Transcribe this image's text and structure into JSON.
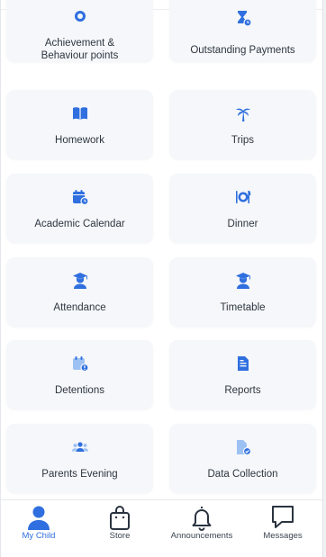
{
  "tiles": [
    {
      "label": "Achievement &\nBehaviour points",
      "icon": "medal-icon"
    },
    {
      "label": "Outstanding Payments",
      "icon": "hourglass-clock-icon"
    },
    {
      "label": "Homework",
      "icon": "book-icon"
    },
    {
      "label": "Trips",
      "icon": "palm-tree-icon"
    },
    {
      "label": "Academic Calendar",
      "icon": "calendar-clock-icon"
    },
    {
      "label": "Dinner",
      "icon": "plate-cutlery-icon"
    },
    {
      "label": "Attendance",
      "icon": "graduate-icon"
    },
    {
      "label": "Timetable",
      "icon": "graduate-icon"
    },
    {
      "label": "Detentions",
      "icon": "calendar-alert-icon"
    },
    {
      "label": "Reports",
      "icon": "report-document-icon"
    },
    {
      "label": "Parents Evening",
      "icon": "people-group-icon"
    },
    {
      "label": "Data Collection",
      "icon": "document-check-icon"
    }
  ],
  "tab_bar": {
    "items": [
      {
        "label": "My Child",
        "icon": "person-icon",
        "active": true
      },
      {
        "label": "Store",
        "icon": "shopping-bag-icon",
        "active": false
      },
      {
        "label": "Announcements",
        "icon": "bell-icon",
        "active": false
      },
      {
        "label": "Messages",
        "icon": "message-bubble-icon",
        "active": false
      }
    ]
  },
  "colors": {
    "accent": "#2f6fdf",
    "tile_background": "#f5f7fa",
    "label": "#2f3640"
  }
}
